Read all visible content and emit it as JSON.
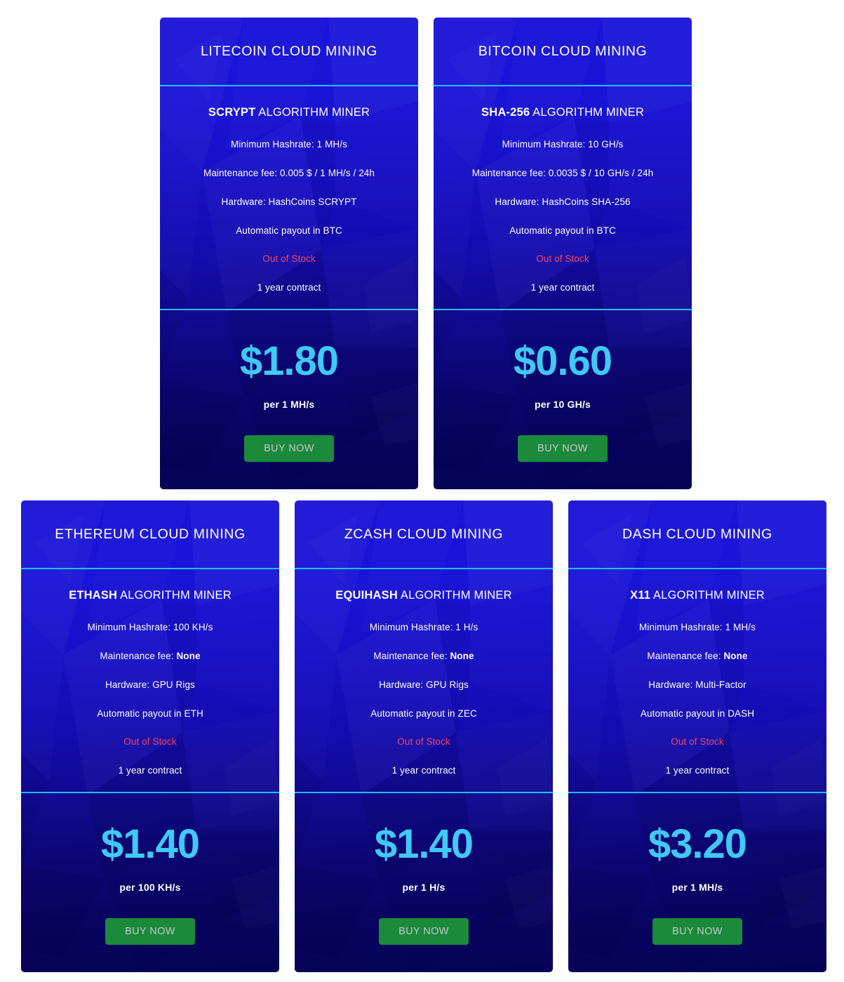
{
  "meta": {
    "accent_divider": "#1ec0f0",
    "price_color": "#3fc9f6",
    "stock_color": "#f6445e",
    "button_color": "#1b8a3a",
    "button_text_color": "#c6c6cf",
    "card_top_color": "#1a14d8",
    "card_bottom_color": "#060356"
  },
  "rows": [
    {
      "cards": [
        {
          "title": "LITECOIN CLOUD MINING",
          "algorithm_name": "SCRYPT",
          "algorithm_suffix": " ALGORITHM MINER",
          "specs": [
            "Minimum Hashrate: 1 MH/s",
            "Maintenance fee: 0.005 $ / 1 MH/s / 24h",
            "Hardware: HashCoins SCRYPT",
            "Automatic payout in BTC"
          ],
          "maintenance_bold": "",
          "stock_status": "Out of Stock",
          "contract": "1 year contract",
          "price": "$1.80",
          "price_unit": "per 1 MH/s",
          "buy_label": "BUY NOW"
        },
        {
          "title": "BITCOIN CLOUD MINING",
          "algorithm_name": "SHA-256",
          "algorithm_suffix": " ALGORITHM MINER",
          "specs": [
            "Minimum Hashrate: 10 GH/s",
            "Maintenance fee: 0.0035 $ / 10 GH/s / 24h",
            "Hardware: HashCoins SHA-256",
            "Automatic payout in BTC"
          ],
          "maintenance_bold": "",
          "stock_status": "Out of Stock",
          "contract": "1 year contract",
          "price": "$0.60",
          "price_unit": "per 10 GH/s",
          "buy_label": "BUY NOW"
        }
      ]
    },
    {
      "cards": [
        {
          "title": "ETHEREUM CLOUD MINING",
          "algorithm_name": "ETHASH",
          "algorithm_suffix": " ALGORITHM MINER",
          "specs": [
            "Minimum Hashrate: 100 KH/s",
            "Maintenance fee: ",
            "Hardware: GPU Rigs",
            "Automatic payout in ETH"
          ],
          "maintenance_bold": "None",
          "stock_status": "Out of Stock",
          "contract": "1 year contract",
          "price": "$1.40",
          "price_unit": "per 100 KH/s",
          "buy_label": "BUY NOW"
        },
        {
          "title": "ZCASH CLOUD MINING",
          "algorithm_name": "EQUIHASH",
          "algorithm_suffix": " ALGORITHM MINER",
          "specs": [
            "Minimum Hashrate: 1 H/s",
            "Maintenance fee: ",
            "Hardware: GPU Rigs",
            "Automatic payout in ZEC"
          ],
          "maintenance_bold": "None",
          "stock_status": "Out of Stock",
          "contract": "1 year contract",
          "price": "$1.40",
          "price_unit": "per 1 H/s",
          "buy_label": "BUY NOW"
        },
        {
          "title": "DASH CLOUD MINING",
          "algorithm_name": "X11",
          "algorithm_suffix": " ALGORITHM MINER",
          "specs": [
            "Minimum Hashrate: 1 MH/s",
            "Maintenance fee: ",
            "Hardware: Multi-Factor",
            "Automatic payout in DASH"
          ],
          "maintenance_bold": "None",
          "stock_status": "Out of Stock",
          "contract": "1 year contract",
          "price": "$3.20",
          "price_unit": "per 1 MH/s",
          "buy_label": "BUY NOW"
        }
      ]
    }
  ]
}
